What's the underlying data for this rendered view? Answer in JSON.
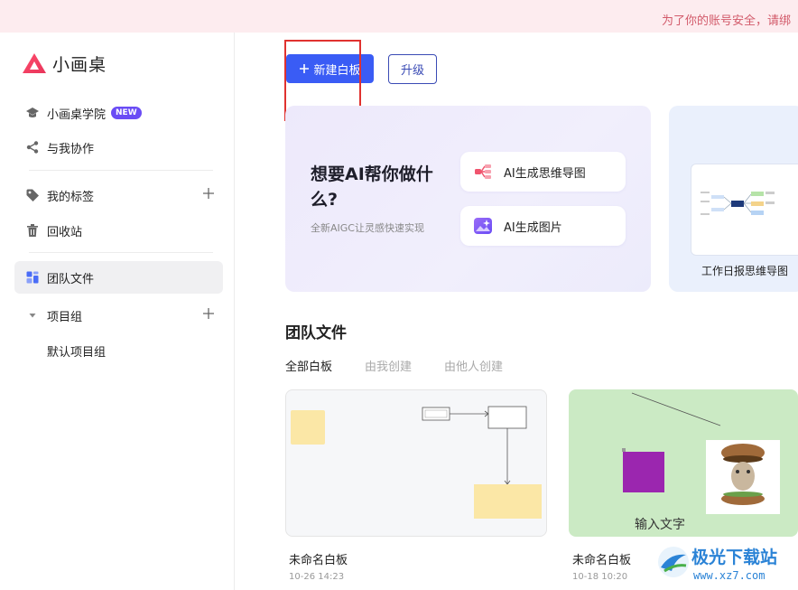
{
  "banner": {
    "text": "为了你的账号安全，请绑"
  },
  "app": {
    "name": "小画桌"
  },
  "sidebar": {
    "academy": "小画桌学院",
    "academy_badge": "NEW",
    "collab": "与我协作",
    "tags": "我的标签",
    "trash": "回收站",
    "team_files": "团队文件",
    "project_group": "项目组",
    "default_project": "默认项目组"
  },
  "toolbar": {
    "new_board": "新建白板",
    "upgrade": "升级"
  },
  "ai_card": {
    "title": "想要AI帮你做什么?",
    "subtitle": "全新AIGC让灵感快速实现",
    "mindmap_btn": "AI生成思维导图",
    "image_btn": "AI生成图片"
  },
  "template": {
    "label": "工作日报思维导图"
  },
  "team": {
    "title": "团队文件",
    "tabs": [
      "全部白板",
      "由我创建",
      "由他人创建"
    ],
    "files": [
      {
        "name": "未命名白板",
        "date": "10-26 14:23"
      },
      {
        "name": "未命名白板",
        "date": "10-18 10:20",
        "thumb_text": "输入文字"
      }
    ]
  },
  "watermark": {
    "line1": "极光下载站",
    "line2": "www.xz7.com"
  },
  "colors": {
    "primary": "#3a5cf5",
    "badge": "#6a4cf5",
    "banner_bg": "#fdecef",
    "annotation": "#e0322f"
  }
}
